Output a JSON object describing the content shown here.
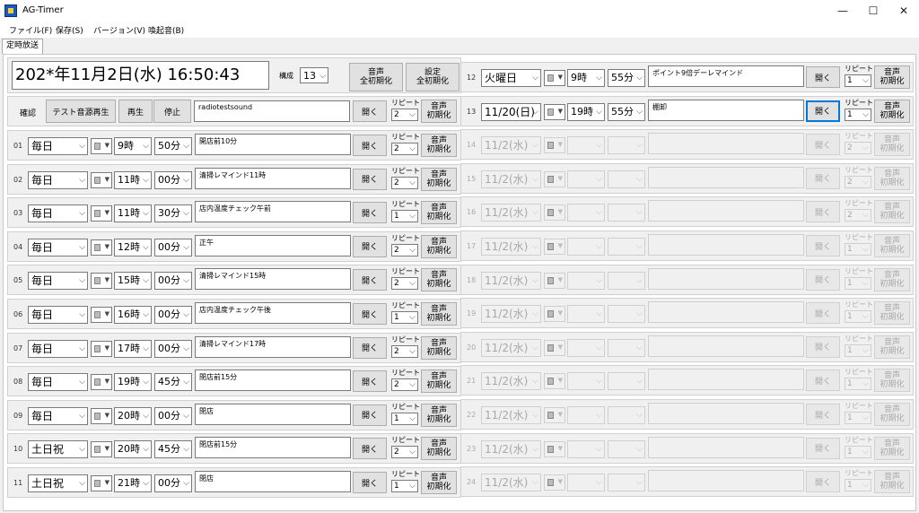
{
  "window": {
    "title": "AG-Timer",
    "min": "—",
    "max": "☐",
    "close": "✕"
  },
  "menu": [
    "ファイル(F)",
    "保存(S)",
    "バージョン(V)",
    "喚起音(B)"
  ],
  "tab": "定時放送",
  "top": {
    "clock": "202*年11月2日(水) 16:50:43",
    "config_label": "構成",
    "config_value": "13",
    "sound_reset": [
      "音声",
      "全初期化"
    ],
    "setting_reset": [
      "設定",
      "全初期化"
    ]
  },
  "test": {
    "label": "確認",
    "test_play": "テスト音源再生",
    "play": "再生",
    "stop": "停止",
    "file": "radiotestsound",
    "open": "開く",
    "repeat_label": "リピート",
    "repeat": "2",
    "reset": [
      "音声",
      "初期化"
    ]
  },
  "common": {
    "open": "開く",
    "repeat_label": "リピート",
    "reset": [
      "音声",
      "初期化"
    ]
  },
  "left_rows": [
    {
      "num": "01",
      "day": "毎日",
      "hour": "9時",
      "min": "50分",
      "msg": "開店前10分",
      "repeat": "2"
    },
    {
      "num": "02",
      "day": "毎日",
      "hour": "11時",
      "min": "00分",
      "msg": "清掃レマインド11時",
      "repeat": "2"
    },
    {
      "num": "03",
      "day": "毎日",
      "hour": "11時",
      "min": "30分",
      "msg": "店内温度チェック午前",
      "repeat": "1"
    },
    {
      "num": "04",
      "day": "毎日",
      "hour": "12時",
      "min": "00分",
      "msg": "正午",
      "repeat": "2"
    },
    {
      "num": "05",
      "day": "毎日",
      "hour": "15時",
      "min": "00分",
      "msg": "清掃レマインド15時",
      "repeat": "2"
    },
    {
      "num": "06",
      "day": "毎日",
      "hour": "16時",
      "min": "00分",
      "msg": "店内温度チェック午後",
      "repeat": "1"
    },
    {
      "num": "07",
      "day": "毎日",
      "hour": "17時",
      "min": "00分",
      "msg": "清掃レマインド17時",
      "repeat": "2"
    },
    {
      "num": "08",
      "day": "毎日",
      "hour": "19時",
      "min": "45分",
      "msg": "閉店前15分",
      "repeat": "2"
    },
    {
      "num": "09",
      "day": "毎日",
      "hour": "20時",
      "min": "00分",
      "msg": "閉店",
      "repeat": "1"
    },
    {
      "num": "10",
      "day": "土日祝",
      "hour": "20時",
      "min": "45分",
      "msg": "閉店前15分",
      "repeat": "2"
    },
    {
      "num": "11",
      "day": "土日祝",
      "hour": "21時",
      "min": "00分",
      "msg": "閉店",
      "repeat": "1"
    }
  ],
  "right_rows": [
    {
      "num": "12",
      "day": "火曜日",
      "hour": "9時",
      "min": "55分",
      "msg": "ポイント9倍デーレマインド",
      "repeat": "1",
      "enabled": true
    },
    {
      "num": "13",
      "day": "11/20(日)",
      "hour": "19時",
      "min": "55分",
      "msg": "棚卸",
      "repeat": "1",
      "enabled": true
    },
    {
      "num": "14",
      "day": "11/2(水)",
      "hour": "",
      "min": "",
      "msg": "",
      "repeat": "2",
      "enabled": false
    },
    {
      "num": "15",
      "day": "11/2(水)",
      "hour": "",
      "min": "",
      "msg": "",
      "repeat": "2",
      "enabled": false
    },
    {
      "num": "16",
      "day": "11/2(水)",
      "hour": "",
      "min": "",
      "msg": "",
      "repeat": "2",
      "enabled": false
    },
    {
      "num": "17",
      "day": "11/2(水)",
      "hour": "",
      "min": "",
      "msg": "",
      "repeat": "1",
      "enabled": false
    },
    {
      "num": "18",
      "day": "11/2(水)",
      "hour": "",
      "min": "",
      "msg": "",
      "repeat": "1",
      "enabled": false
    },
    {
      "num": "19",
      "day": "11/2(水)",
      "hour": "",
      "min": "",
      "msg": "",
      "repeat": "1",
      "enabled": false
    },
    {
      "num": "20",
      "day": "11/2(水)",
      "hour": "",
      "min": "",
      "msg": "",
      "repeat": "1",
      "enabled": false
    },
    {
      "num": "21",
      "day": "11/2(水)",
      "hour": "",
      "min": "",
      "msg": "",
      "repeat": "1",
      "enabled": false
    },
    {
      "num": "22",
      "day": "11/2(水)",
      "hour": "",
      "min": "",
      "msg": "",
      "repeat": "1",
      "enabled": false
    },
    {
      "num": "23",
      "day": "11/2(水)",
      "hour": "",
      "min": "",
      "msg": "",
      "repeat": "1",
      "enabled": false
    },
    {
      "num": "24",
      "day": "11/2(水)",
      "hour": "",
      "min": "",
      "msg": "",
      "repeat": "1",
      "enabled": false
    }
  ],
  "icons": {
    "sound_select": "speaker-select-icon",
    "dropdown": "chevron-down-icon",
    "app": "ag-timer-app-icon"
  }
}
